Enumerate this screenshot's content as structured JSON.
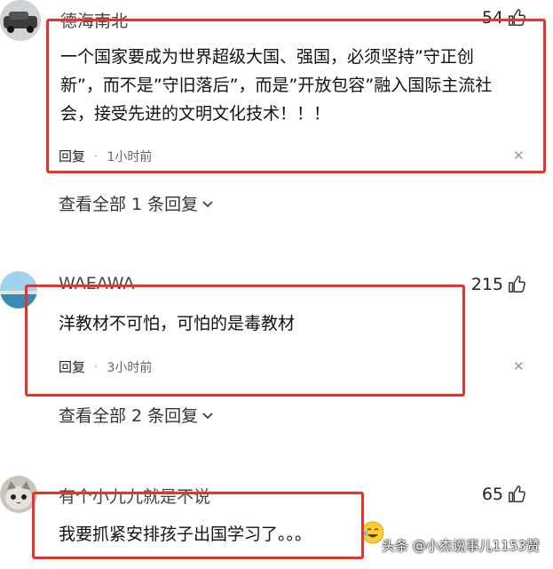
{
  "comments": [
    {
      "username": "德海南北",
      "likes": "54",
      "content": "一个国家要成为世界超级大国、强国，必须坚持”守正创新”，而不是”守旧落后”，而是”开放包容”融入国际主流社会，接受先进的文明文化技术！！！",
      "reply_label": "回复",
      "time": "1小时前",
      "view_replies": "查看全部 1 条回复"
    },
    {
      "username": "WAEAWA",
      "likes": "215",
      "content": "洋教材不可怕，可怕的是毒教材",
      "reply_label": "回复",
      "time": "3小时前",
      "view_replies": "查看全部 2 条回复"
    },
    {
      "username": "有个小九九就是不说",
      "likes": "65",
      "content": "我要抓紧安排孩子出国学习了。。。"
    }
  ],
  "watermark": "头条 @小杰说事儿1153赞",
  "colors": {
    "highlight_box": "#e8332d",
    "text": "#111111",
    "meta": "#666666"
  },
  "icons": [
    "thumbs-up-icon",
    "close-icon",
    "chevron-down-icon",
    "laughing-emoji-icon"
  ]
}
